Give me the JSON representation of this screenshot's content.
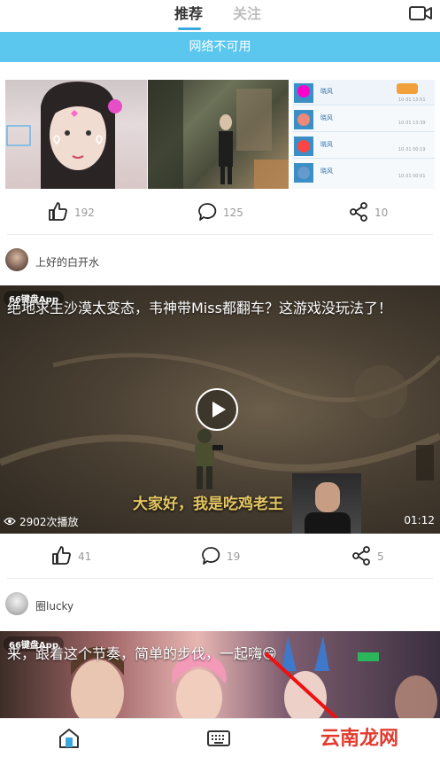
{
  "tabs": {
    "recommend": "推荐",
    "follow": "关注"
  },
  "icons": {
    "video": "video-camera-icon",
    "like": "thumbs-up-icon",
    "comment": "comment-bubble-icon",
    "share": "share-icon",
    "play": "play-icon",
    "eye": "eye-icon",
    "home": "home-icon",
    "keyboard": "keyboard-icon"
  },
  "banner": {
    "text": "网络不可用"
  },
  "post1": {
    "likes": "192",
    "comments": "125",
    "shares": "10",
    "rows": [
      {
        "name": "晓风",
        "meta": "10-31 13:51"
      },
      {
        "name": "晓风",
        "meta": "10-31 13:39"
      },
      {
        "name": "晓风",
        "meta": "10-31 00:19"
      },
      {
        "name": "晓风",
        "meta": "10-31 00:01"
      }
    ]
  },
  "author1": {
    "name": "上好的白开水"
  },
  "video1": {
    "watermark": "66键盘App",
    "title": "绝地求生沙漠太变态，韦神带Miss都翻车？这游戏没玩法了！",
    "subtitle": "大家好，我是吃鸡老王",
    "plays": "2902次播放",
    "duration": "01:12",
    "likes": "41",
    "comments": "19",
    "shares": "5"
  },
  "author2": {
    "name": "圈lucky"
  },
  "video2": {
    "watermark": "66键盘App",
    "title": "来，跟着这个节奏，简单的步伐，一起嗨😁"
  },
  "site_watermark": "云南龙网",
  "colors": {
    "accent": "#3aa8df",
    "banner": "#5bc7ef",
    "watermark": "#e23b2e"
  }
}
